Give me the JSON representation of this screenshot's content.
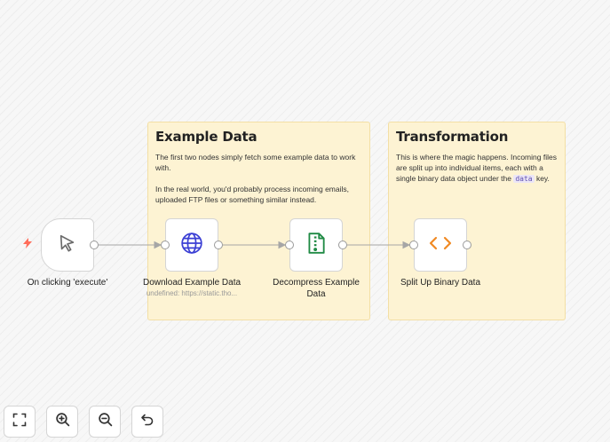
{
  "stickies": {
    "example": {
      "title": "Example Data",
      "p1": "The first two nodes simply fetch some example data to work with.",
      "p2": "In the real world, you'd probably process incoming emails, uploaded FTP files or something similar instead."
    },
    "transform": {
      "title": "Transformation",
      "p1_before": "This is where the magic happens. Incoming files are split up into individual items, each with a single binary data object under the ",
      "p1_code": "data",
      "p1_after": " key."
    }
  },
  "nodes": {
    "trigger": {
      "label": "On clicking 'execute'",
      "icon": "cursor-icon"
    },
    "download": {
      "label": "Download Example Data",
      "sublabel": "undefined: https://static.tho...",
      "icon": "globe-icon",
      "color": "#3b3fd4"
    },
    "decompress": {
      "label": "Decompress Example Data",
      "icon": "zip-file-icon",
      "color": "#1f8a44"
    },
    "split": {
      "label": "Split Up Binary Data",
      "icon": "code-icon",
      "color": "#f08a24"
    }
  },
  "colors": {
    "trigger_bolt": "#ff6d5a",
    "sticky_bg": "#fdf3d3"
  },
  "controls": [
    "fit-view",
    "zoom-in",
    "zoom-out",
    "reset-zoom"
  ]
}
